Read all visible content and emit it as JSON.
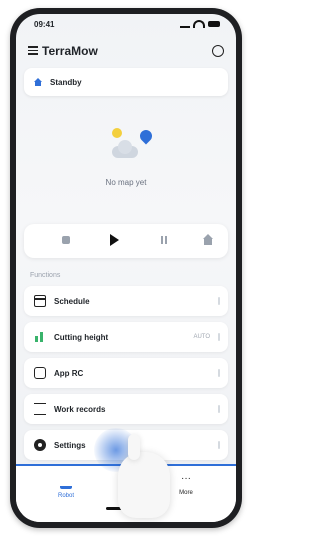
{
  "status_bar": {
    "time": "09:41"
  },
  "app": {
    "title": "TerraMow"
  },
  "status": {
    "text": "Standby"
  },
  "map": {
    "empty_text": "No map yet"
  },
  "controls": {
    "items": [
      "stop",
      "start",
      "pause",
      "return-home"
    ]
  },
  "section": {
    "label": "Functions"
  },
  "menu": {
    "items": [
      {
        "label": "Schedule",
        "value": ""
      },
      {
        "label": "Cutting height",
        "value": "AUTO"
      },
      {
        "label": "App RC",
        "value": ""
      },
      {
        "label": "Work records",
        "value": ""
      },
      {
        "label": "Settings",
        "value": ""
      }
    ]
  },
  "tabbar": {
    "tabs": [
      "Robot",
      "More"
    ]
  },
  "colors": {
    "accent": "#2f6fd8"
  }
}
